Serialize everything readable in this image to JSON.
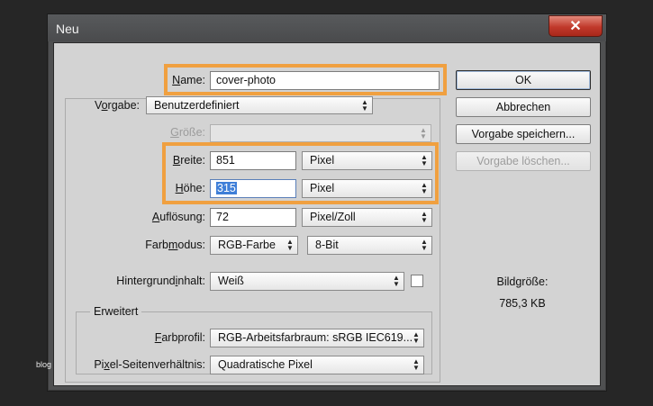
{
  "window": {
    "title": "Neu",
    "close_glyph": "✕"
  },
  "name": {
    "label_pre": "",
    "label_key": "N",
    "label_post": "ame:",
    "value": "cover-photo"
  },
  "vorgabe": {
    "label_pre": "V",
    "label_key": "o",
    "label_post": "rgabe:",
    "value": "Benutzerdefiniert"
  },
  "groesse": {
    "label_pre": "",
    "label_key": "G",
    "label_post": "röße:",
    "value": ""
  },
  "breite": {
    "label_pre": "",
    "label_key": "B",
    "label_post": "reite:",
    "value": "851",
    "unit": "Pixel"
  },
  "hoehe": {
    "label_pre": "",
    "label_key": "H",
    "label_post": "öhe:",
    "value": "315",
    "unit": "Pixel"
  },
  "aufloesung": {
    "label_pre": "",
    "label_key": "A",
    "label_post": "uflösung:",
    "value": "72",
    "unit": "Pixel/Zoll"
  },
  "farbmodus": {
    "label_pre": "Farb",
    "label_key": "m",
    "label_post": "odus:",
    "value": "RGB-Farbe",
    "depth": "8-Bit"
  },
  "hintergrund": {
    "label_pre": "Hintergrund",
    "label_key": "i",
    "label_post": "nhalt:",
    "value": "Weiß"
  },
  "erweitert": {
    "title": "Erweitert"
  },
  "farbprofil": {
    "label_pre": "",
    "label_key": "F",
    "label_post": "arbprofil:",
    "value": "RGB-Arbeitsfarbraum:  sRGB IEC619..."
  },
  "pixel_ratio": {
    "label_pre": "Pi",
    "label_key": "x",
    "label_post": "el-Seitenverhältnis:",
    "value": "Quadratische Pixel"
  },
  "buttons": {
    "ok": "OK",
    "abbrechen": "Abbrechen",
    "speichern": "Vorgabe speichern...",
    "loeschen": "Vorgabe löschen..."
  },
  "bildgroesse": {
    "label": "Bildgröße:",
    "value": "785,3 KB"
  },
  "watermark": "blog",
  "colors": {
    "highlight": "#f0a040",
    "selection": "#3f7fd8"
  },
  "icons": {
    "select_arrow": "up-down-arrows-icon",
    "close": "close-icon"
  }
}
